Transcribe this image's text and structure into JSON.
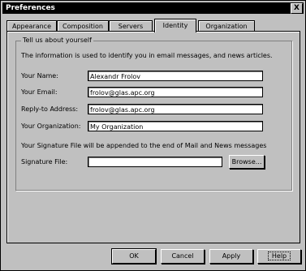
{
  "window": {
    "title": "Preferences",
    "close_glyph": "X"
  },
  "tabs": [
    {
      "label": "Appearance"
    },
    {
      "label": "Composition"
    },
    {
      "label": "Servers"
    },
    {
      "label": "Identity",
      "active": true
    },
    {
      "label": "Organization"
    }
  ],
  "identity": {
    "group_title": "Tell us about yourself",
    "description": "The information is used to identify you in email messages, and news articles.",
    "fields": {
      "name": {
        "label": "Your Name:",
        "value": "Alexandr Frolov"
      },
      "email": {
        "label": "Your Email:",
        "value": "frolov@glas.apc.org"
      },
      "reply_to": {
        "label": "Reply-to Address:",
        "value": "frolov@glas.apc.org"
      },
      "organization": {
        "label": "Your Organization:",
        "value": "My Organization"
      }
    },
    "signature_note": "Your Signature File will be appended to the end of Mail and News messages",
    "signature": {
      "label": "Signature File:",
      "value": "",
      "browse_label": "Browse..."
    }
  },
  "buttons": {
    "ok": "OK",
    "cancel": "Cancel",
    "apply": "Apply",
    "help": "Help"
  }
}
